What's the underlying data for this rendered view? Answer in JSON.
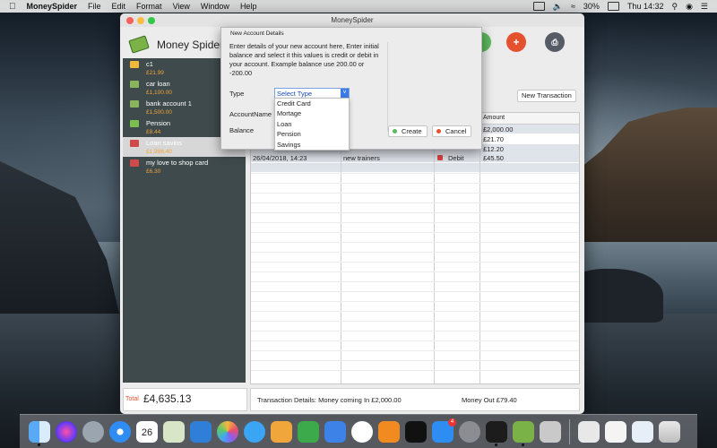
{
  "menubar": {
    "app": "MoneySpider",
    "items": [
      "File",
      "Edit",
      "Format",
      "View",
      "Window",
      "Help"
    ],
    "battery": "30%",
    "clock": "Thu 14:32"
  },
  "window": {
    "title": "MoneySpider",
    "app_name": "Money Spider"
  },
  "sidebar": {
    "accounts": [
      {
        "name": "c1",
        "balance": "£21.99",
        "icon_color": "#f2b93b",
        "icon": "coins-icon"
      },
      {
        "name": "car loan",
        "balance": "£1,100.00",
        "icon_color": "#8bb35b",
        "icon": "money-icon"
      },
      {
        "name": "bank account 1",
        "balance": "£1,500.00",
        "icon_color": "#8bb35b",
        "icon": "bank-icon"
      },
      {
        "name": "Pension",
        "balance": "£8.44",
        "icon_color": "#7bbf4f",
        "icon": "pension-icon"
      },
      {
        "name": "Loan savins",
        "balance": "£1,998.40",
        "icon_color": "#d04a4a",
        "icon": "savings-icon",
        "selected": true
      },
      {
        "name": "my love to shop card",
        "balance": "£6.30",
        "icon_color": "#d04a4a",
        "icon": "card-icon"
      }
    ]
  },
  "toolbar": {
    "new_transaction": "New Transaction"
  },
  "table": {
    "amount_header": "Amount",
    "amounts": [
      "£2,000.00",
      "£21.70",
      "£12.20",
      "£45.50"
    ],
    "last_row": {
      "date": "26/04/2018, 14:23",
      "description": "new trainers",
      "type": "Debit"
    }
  },
  "footer": {
    "total_label": "Total",
    "total_value": "£4,635.13",
    "tx_details": "Transaction Details: Money coming In  £2,000.00",
    "money_out": "Money Out   £79.40"
  },
  "dialog": {
    "title": "New Account Details",
    "intro": "Enter details of your new account here, Enter initial balance and select it this values is credit or debit in your account. Example balance use 200.00 or -200.00",
    "type_label": "Type",
    "account_name_label": "AccountName",
    "balance_label": "Balance",
    "selected_type": "Select Type",
    "type_options": [
      "Credit Card",
      "Mortage",
      "Loan",
      "Pension",
      "Savings"
    ],
    "create": "Create",
    "cancel": "Cancel",
    "create_color": "#5cb85c",
    "cancel_color": "#e5502f"
  },
  "dock": {
    "calendar_date": "26",
    "appstore_badge": "4",
    "apps": [
      "finder-icon",
      "siri-icon",
      "rocket-icon",
      "safari-icon",
      "calendar-icon",
      "preview-icon",
      "xcode-icon",
      "photos-icon",
      "messages-icon",
      "pages-icon",
      "numbers-icon",
      "keynote-icon",
      "music-icon",
      "books-icon",
      "wifi-icon",
      "appstore-icon",
      "settings-icon",
      "terminal-icon",
      "moneyspider-icon",
      "scissors-icon",
      "lock-icon",
      "documents-icon",
      "mail-icon",
      "trash-icon"
    ]
  }
}
